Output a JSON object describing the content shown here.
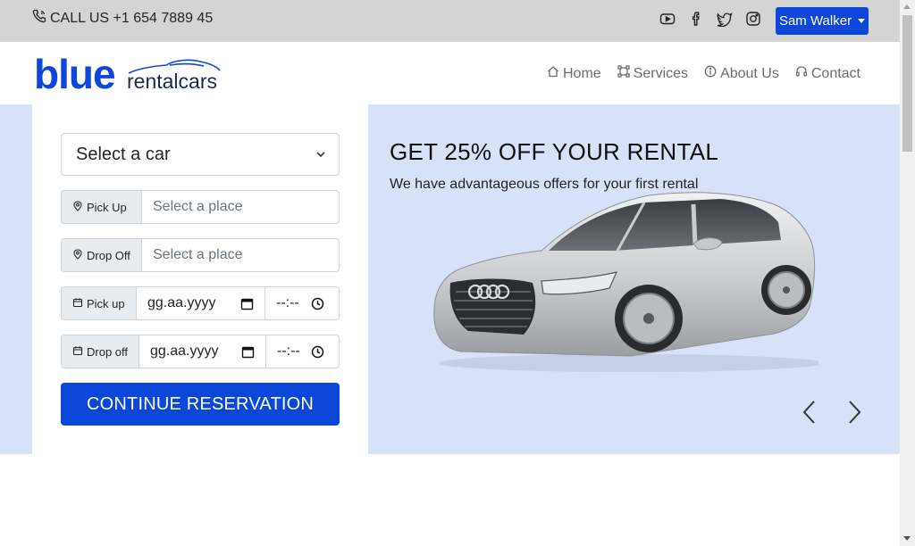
{
  "topbar": {
    "call_text": "CALL US +1 654 7889 45",
    "socials": [
      "youtube-icon",
      "facebook-icon",
      "twitter-icon",
      "instagram-icon"
    ],
    "user_name": "Sam Walker"
  },
  "header": {
    "logo_main": "blue",
    "logo_sub": "rentalcars",
    "nav": [
      {
        "label": "Home",
        "icon": "home-icon"
      },
      {
        "label": "Services",
        "icon": "services-icon"
      },
      {
        "label": "About Us",
        "icon": "info-icon"
      },
      {
        "label": "Contact",
        "icon": "headset-icon"
      }
    ]
  },
  "form": {
    "car_select": "Select a car",
    "pickup_label": "Pick Up",
    "pickup_placeholder": "Select a place",
    "dropoff_label": "Drop Off",
    "dropoff_placeholder": "Select a place",
    "pickup_date_label": "Pick up",
    "dropoff_date_label": "Drop off",
    "date_placeholder": "gg.aa.yyyy",
    "time_placeholder": "--:--",
    "submit_label": "CONTINUE RESERVATION"
  },
  "promo": {
    "title": "GET 25% OFF YOUR RENTAL",
    "subtitle": "We have advantageous offers for your first rental"
  },
  "colors": {
    "brand": "#0d47d9",
    "hero_bg": "#d7e1f7",
    "topbar_bg": "#d4d4d4"
  }
}
